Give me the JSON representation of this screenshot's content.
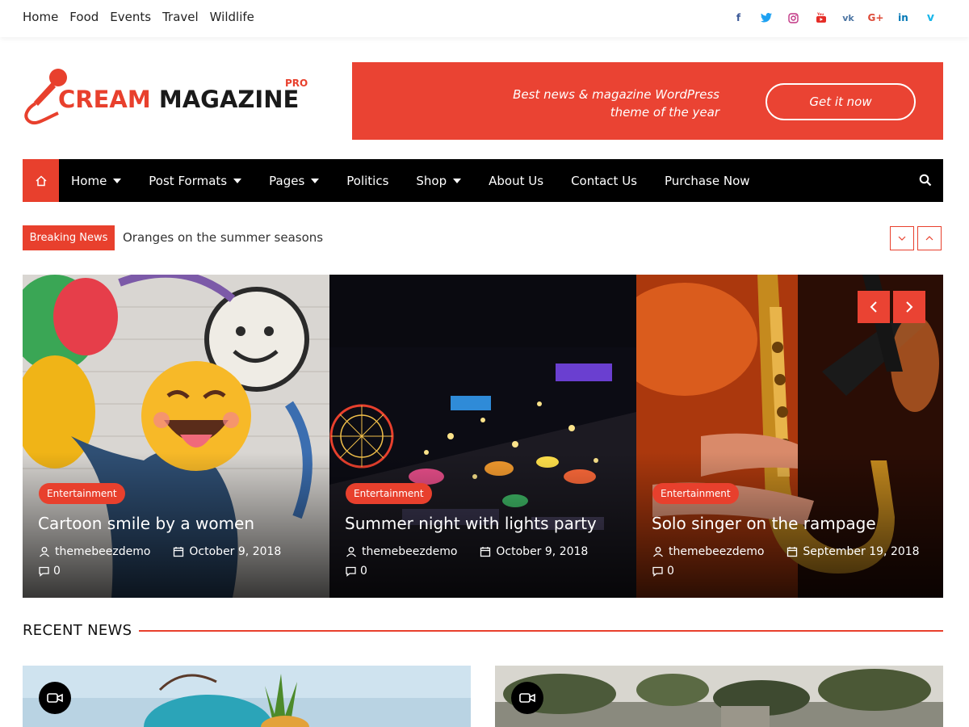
{
  "topbar": {
    "nav": [
      "Home",
      "Food",
      "Events",
      "Travel",
      "Wildlife"
    ],
    "social": [
      {
        "icon": "facebook-icon",
        "glyph": "f",
        "color": "#3b5998"
      },
      {
        "icon": "twitter-icon",
        "glyph": "t",
        "color": "#1da1f2"
      },
      {
        "icon": "instagram-icon",
        "glyph": "◎",
        "color": "#c13584"
      },
      {
        "icon": "youtube-icon",
        "glyph": "▶",
        "color": "#e52d27"
      },
      {
        "icon": "vk-icon",
        "glyph": "vk",
        "color": "#4c75a3"
      },
      {
        "icon": "google-plus-icon",
        "glyph": "G+",
        "color": "#dd4b39"
      },
      {
        "icon": "linkedin-icon",
        "glyph": "in",
        "color": "#0077b5"
      },
      {
        "icon": "vimeo-icon",
        "glyph": "v",
        "color": "#1ab7ea"
      }
    ]
  },
  "logo": {
    "word1": "CREAM",
    "word2": "MAGAZINE",
    "badge": "PRO"
  },
  "banner": {
    "line1": "Best news & magazine WordPress",
    "line2": "theme of the year",
    "button": "Get it now"
  },
  "mainnav": {
    "items": [
      {
        "label": "Home",
        "has_dropdown": true
      },
      {
        "label": "Post Formats",
        "has_dropdown": true
      },
      {
        "label": "Pages",
        "has_dropdown": true
      },
      {
        "label": "Politics",
        "has_dropdown": false
      },
      {
        "label": "Shop",
        "has_dropdown": true
      },
      {
        "label": "About Us",
        "has_dropdown": false
      },
      {
        "label": "Contact Us",
        "has_dropdown": false
      },
      {
        "label": "Purchase Now",
        "has_dropdown": false
      }
    ]
  },
  "breaking": {
    "label": "Breaking News",
    "headline": "Oranges on the summer seasons"
  },
  "slides": [
    {
      "category": "Entertainment",
      "title": "Cartoon smile by a women",
      "author": "themebeezdemo",
      "date": "October 9, 2018",
      "comments": "0"
    },
    {
      "category": "Entertainment",
      "title": "Summer night with lights party",
      "author": "themebeezdemo",
      "date": "October 9, 2018",
      "comments": "0"
    },
    {
      "category": "Entertainment",
      "title": "Solo singer on the rampage",
      "author": "themebeezdemo",
      "date": "September 19, 2018",
      "comments": "0"
    }
  ],
  "recent": {
    "title": "RECENT NEWS"
  },
  "colors": {
    "accent": "#e8402d",
    "nav_bg": "#000000"
  }
}
